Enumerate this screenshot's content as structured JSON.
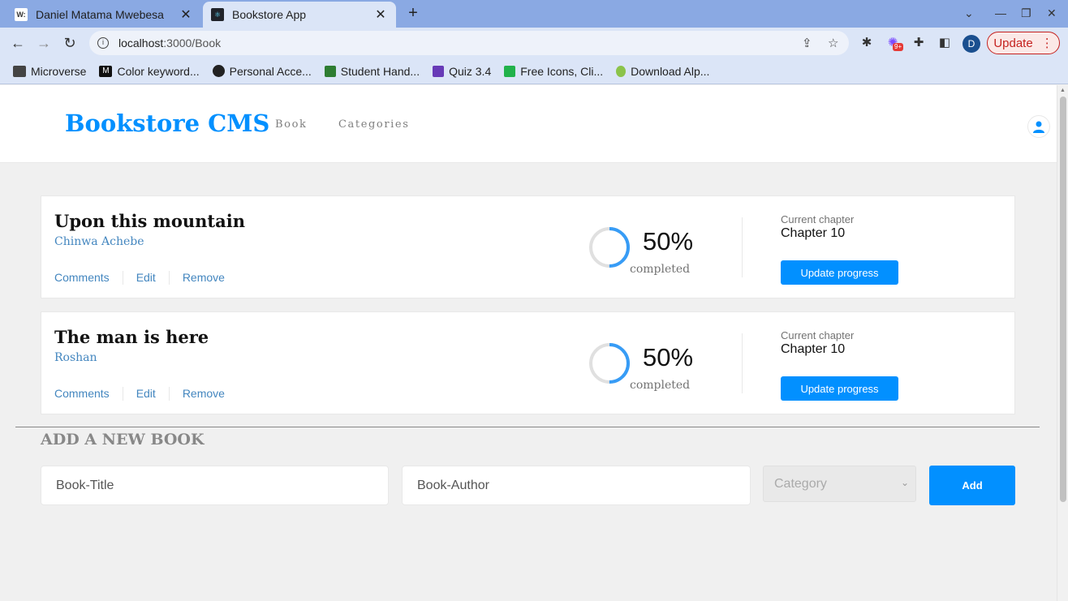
{
  "browser": {
    "tabs": [
      {
        "title": "Daniel Matama Mwebesa",
        "favicon": "W:",
        "active": false
      },
      {
        "title": "Bookstore App",
        "favicon": "react-icon",
        "active": true
      }
    ],
    "url_host": "localhost",
    "url_path": ":3000/Book",
    "update_label": "Update",
    "profile_initial": "D",
    "extension_badge": "9+",
    "bookmarks": [
      {
        "label": "Microverse",
        "icon": "folder-icon",
        "color": "#444444"
      },
      {
        "label": "Color keyword...",
        "icon": "mdn-icon",
        "color": "#111111"
      },
      {
        "label": "Personal Acce...",
        "icon": "github-icon",
        "color": "#222222"
      },
      {
        "label": "Student Hand...",
        "icon": "notion-icon",
        "color": "#2e7d32"
      },
      {
        "label": "Quiz 3.4",
        "icon": "form-icon",
        "color": "#673ab7"
      },
      {
        "label": "Free Icons, Cli...",
        "icon": "flaticon-icon",
        "color": "#21b24b"
      },
      {
        "label": "Download Alp...",
        "icon": "alpine-icon",
        "color": "#8bc34a"
      }
    ]
  },
  "header": {
    "logo": "Bookstore CMS",
    "nav": [
      "Book",
      "Categories"
    ]
  },
  "books": [
    {
      "title": "Upon this mountain",
      "author": "Chinwa Achebe",
      "actions": [
        "Comments",
        "Edit",
        "Remove"
      ],
      "progress_percent": 50,
      "percent_label": "50%",
      "completed_label": "completed",
      "chapter_label": "Current chapter",
      "chapter": "Chapter 10",
      "update_label": "Update progress"
    },
    {
      "title": "The man is here",
      "author": "Roshan",
      "actions": [
        "Comments",
        "Edit",
        "Remove"
      ],
      "progress_percent": 50,
      "percent_label": "50%",
      "completed_label": "completed",
      "chapter_label": "Current chapter",
      "chapter": "Chapter 10",
      "update_label": "Update progress"
    }
  ],
  "form": {
    "title": "ADD A NEW BOOK",
    "title_placeholder": "Book-Title",
    "author_placeholder": "Book-Author",
    "category_placeholder": "Category",
    "add_label": "Add"
  },
  "colors": {
    "primary": "#0290ff",
    "link": "#4386bf",
    "progress": "#379cf6",
    "track": "#e8e8e8",
    "tabstrip": "#8aa9e3",
    "toolbar": "#dbe5f7"
  }
}
